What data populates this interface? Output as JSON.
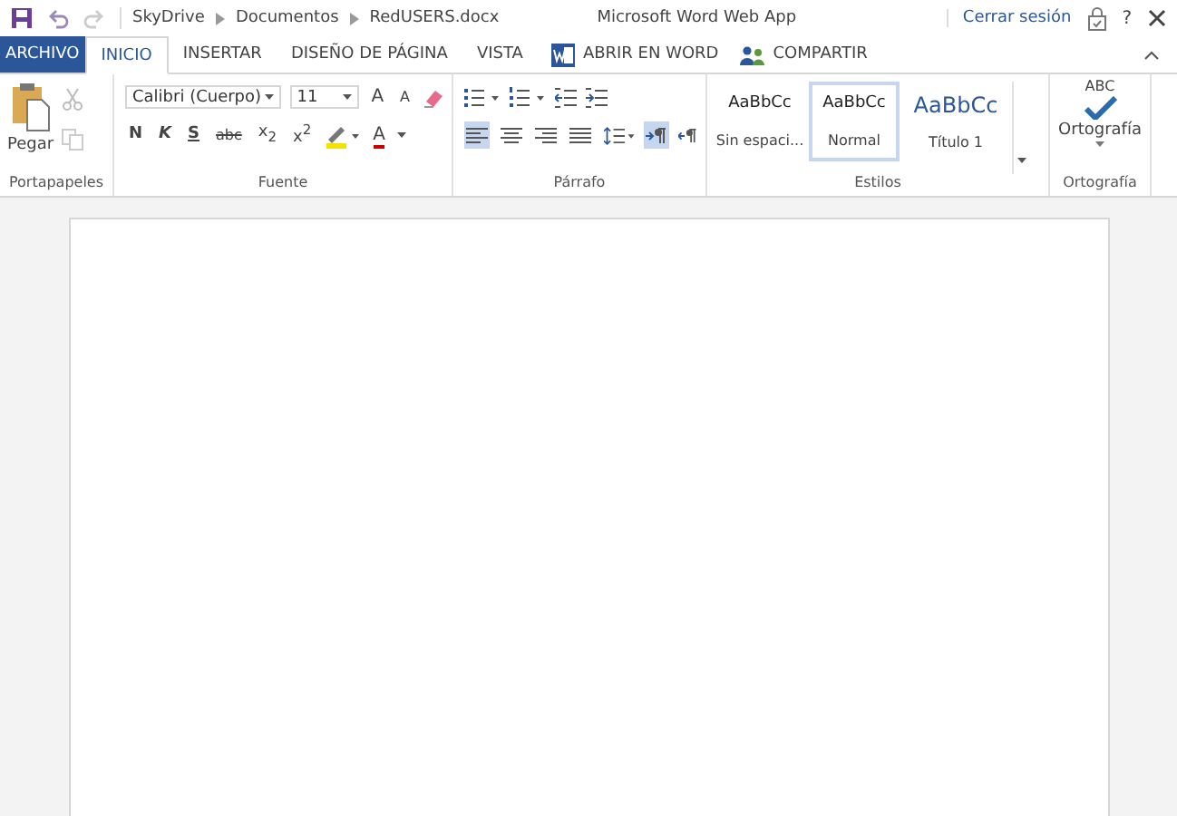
{
  "breadcrumb": [
    "SkyDrive",
    "Documentos",
    "RedUSERS.docx"
  ],
  "app_title": "Microsoft Word Web App",
  "sign_out": "Cerrar sesión",
  "help": "?",
  "tabs": [
    {
      "label": "ARCHIVO",
      "kind": "file",
      "selected": false
    },
    {
      "label": "INICIO",
      "kind": "tab",
      "selected": true
    },
    {
      "label": "INSERTAR",
      "kind": "tab",
      "selected": false
    },
    {
      "label": "DISEÑO DE PÁGINA",
      "kind": "tab",
      "selected": false
    },
    {
      "label": "VISTA",
      "kind": "tab",
      "selected": false
    },
    {
      "label": "ABRIR EN WORD",
      "kind": "word",
      "selected": false
    },
    {
      "label": "COMPARTIR",
      "kind": "share",
      "selected": false
    }
  ],
  "clipboard": {
    "paste": "Pegar",
    "label": "Portapapeles"
  },
  "font": {
    "name": "Calibri (Cuerpo)",
    "size": "11",
    "grow": "A",
    "shrink": "A",
    "color_letter": "A",
    "label": "Fuente",
    "formats": [
      "N",
      "K",
      "S",
      "abc",
      "x$_{2}$",
      "x$^{2}$"
    ]
  },
  "paragraph": {
    "label": "Párrafo",
    "align": [
      {
        "selected": true
      },
      {
        "selected": false
      },
      {
        "selected": false
      },
      {
        "selected": false
      }
    ],
    "ltr_selected": true
  },
  "styles": {
    "label": "Estilos",
    "items": [
      {
        "sample": "AaBbCc",
        "name": "Sin espaci...",
        "kind": "plain",
        "selected": false
      },
      {
        "sample": "AaBbCc",
        "name": "Normal",
        "kind": "plain",
        "selected": true
      },
      {
        "sample": "AaBbCc",
        "name": "Título 1",
        "kind": "heading",
        "selected": false
      }
    ]
  },
  "spelling": {
    "abc": "ABC",
    "button": "Ortografía",
    "label": "Ortografía"
  }
}
